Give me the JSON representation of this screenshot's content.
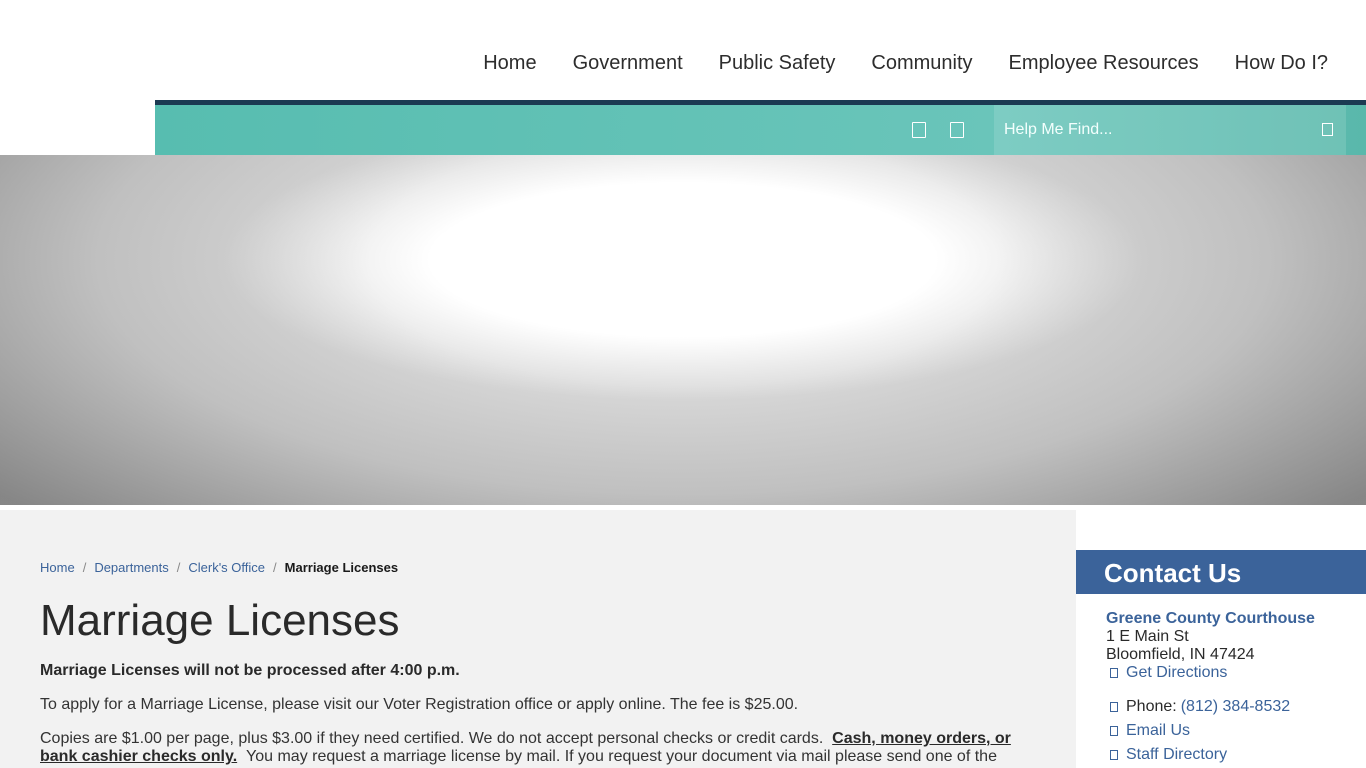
{
  "nav": {
    "items": [
      "Home",
      "Government",
      "Public Safety",
      "Community",
      "Employee Resources",
      "How Do I?"
    ]
  },
  "toolbar": {
    "icons": [
      "translate-icon",
      "share-icon"
    ],
    "search_placeholder": "Help Me Find...",
    "search_icon": "search-icon"
  },
  "breadcrumb": {
    "items": [
      "Home",
      "Departments",
      "Clerk's Office"
    ],
    "separator": "/",
    "current": "Marriage Licenses"
  },
  "content": {
    "title": "Marriage Licenses",
    "notice": "Marriage Licenses will not be processed after 4:00 p.m.",
    "para1": "To apply for a Marriage License, please visit our Voter Registration office or apply online. The fee is $25.00.",
    "para2_a": "Copies are $1.00 per page, plus $3.00 if they need certified.  We do not accept personal checks or credit cards.",
    "para2_emph": "Cash, money orders, or bank cashier checks only.",
    "para2_b": "You may request a marriage license by mail. If you request your document via mail please send one of the"
  },
  "contact": {
    "title": "Contact Us",
    "office": "Greene County Courthouse",
    "address1": "1 E Main St",
    "address2": "Bloomfield, IN 47424",
    "directions": "Get Directions",
    "phone_label": "Phone:",
    "phone": "(812) 384-8532",
    "email": "Email Us",
    "staff": "Staff Directory"
  },
  "colors": {
    "accent": "#3b639a",
    "teal": "#5fbfb3",
    "navy": "#1b3a52"
  }
}
